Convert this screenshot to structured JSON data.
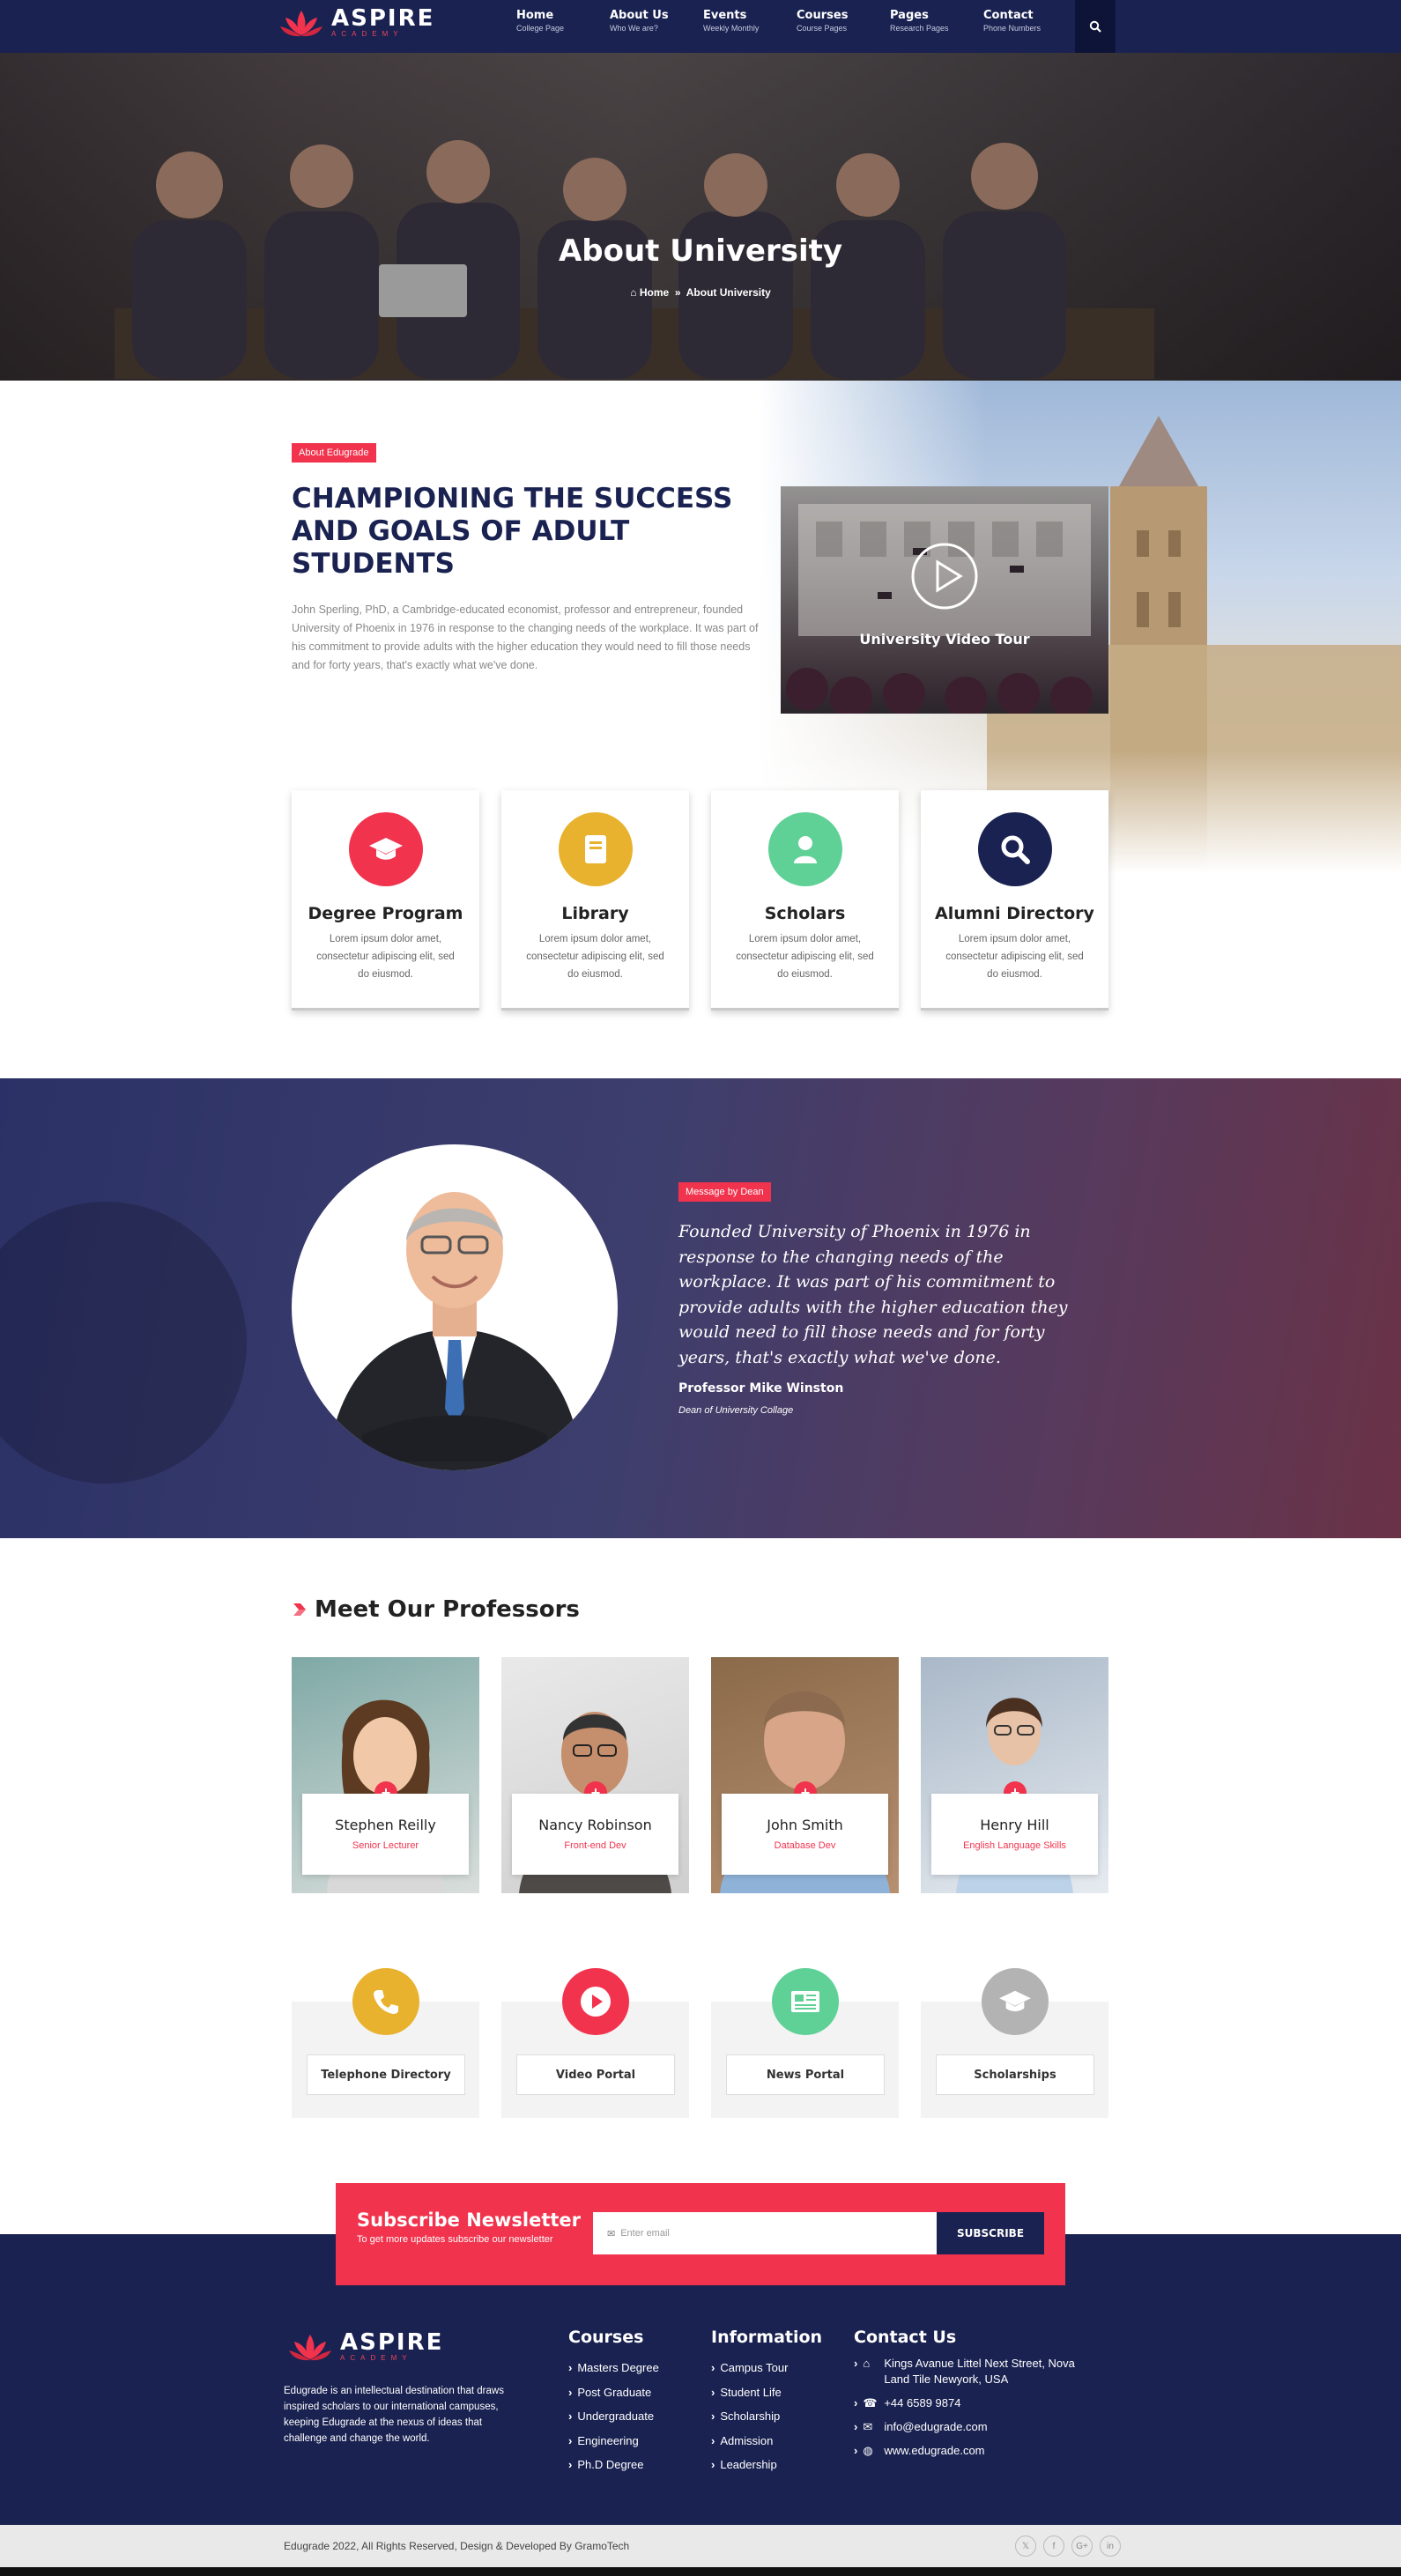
{
  "brand": {
    "name": "ASPIRE",
    "tagline": "ACADEMY",
    "accent": "#f1334d",
    "navy": "#1a2251"
  },
  "nav": {
    "items": [
      {
        "label": "Home",
        "sub": "College Page"
      },
      {
        "label": "About Us",
        "sub": "Who We are?"
      },
      {
        "label": "Events",
        "sub": "Weekly Monthly"
      },
      {
        "label": "Courses",
        "sub": "Course Pages"
      },
      {
        "label": "Pages",
        "sub": "Research Pages"
      },
      {
        "label": "Contact",
        "sub": "Phone Numbers"
      }
    ],
    "search_icon": "search-icon"
  },
  "hero": {
    "title": "About University",
    "breadcrumb": {
      "home": "Home",
      "current": "About University"
    }
  },
  "about": {
    "tag": "About Edugrade",
    "heading": "CHAMPIONING THE SUCCESS AND GOALS OF ADULT STUDENTS",
    "body": "John Sperling, PhD, a Cambridge-educated economist, professor and entrepreneur, founded University of Phoenix in 1976 in response to the changing needs of the workplace. It was part of his commitment to provide adults with the higher education they would need to fill those needs and for forty years, that's exactly what we've done.",
    "video_title": "University Video Tour"
  },
  "features": [
    {
      "title": "Degree Program",
      "desc": "Lorem ipsum dolor amet, consectetur adipiscing elit, sed do eiusmod.",
      "color": "#f1334d",
      "icon": "graduation-cap-icon"
    },
    {
      "title": "Library",
      "desc": "Lorem ipsum dolor amet, consectetur adipiscing elit, sed do eiusmod.",
      "color": "#e8b22e",
      "icon": "book-icon"
    },
    {
      "title": "Scholars",
      "desc": "Lorem ipsum dolor amet, consectetur adipiscing elit, sed do eiusmod.",
      "color": "#5fd197",
      "icon": "user-icon"
    },
    {
      "title": "Alumni Directory",
      "desc": "Lorem ipsum dolor amet, consectetur adipiscing elit, sed do eiusmod.",
      "color": "#1a2251",
      "icon": "search-icon"
    }
  ],
  "dean": {
    "tag": "Message by Dean",
    "quote": "Founded University of Phoenix in 1976 in response to the changing needs of the workplace. It was part of his commitment to provide adults with the higher education they would need to fill those needs and for forty years, that's exactly what we've done.",
    "name": "Professor Mike Winston",
    "role": "Dean of University Collage"
  },
  "professors": {
    "title": "Meet Our Professors",
    "items": [
      {
        "name": "Stephen Reilly",
        "role": "Senior Lecturer"
      },
      {
        "name": "Nancy Robinson",
        "role": "Front-end Dev"
      },
      {
        "name": "John Smith",
        "role": "Database Dev"
      },
      {
        "name": "Henry Hill",
        "role": "English Language Skills"
      }
    ]
  },
  "portals": [
    {
      "label": "Telephone Directory",
      "color": "#e8b22e",
      "icon": "phone-icon"
    },
    {
      "label": "Video Portal",
      "color": "#f1334d",
      "icon": "play-icon"
    },
    {
      "label": "News Portal",
      "color": "#5fd197",
      "icon": "newspaper-icon"
    },
    {
      "label": "Scholarships",
      "color": "#b3b3b3",
      "icon": "graduation-cap-icon"
    }
  ],
  "newsletter": {
    "title": "Subscribe Newsletter",
    "text": "To get more updates subscribe our newsletter",
    "placeholder": "Enter email",
    "button": "SUBSCRIBE"
  },
  "footer": {
    "about": "Edugrade is an intellectual destination that draws inspired scholars to our international campuses, keeping Edugrade at the nexus of ideas that challenge and change the world.",
    "courses": {
      "title": "Courses",
      "items": [
        "Masters Degree",
        "Post Graduate",
        "Undergraduate",
        "Engineering",
        "Ph.D Degree"
      ]
    },
    "information": {
      "title": "Information",
      "items": [
        "Campus Tour",
        "Student Life",
        "Scholarship",
        "Admission",
        "Leadership"
      ]
    },
    "contact": {
      "title": "Contact Us",
      "address": "Kings Avanue Littel Next Street, Nova Land Tile Newyork, USA",
      "phone": "+44 6589 9874",
      "email": "info@edugrade.com",
      "website": "www.edugrade.com"
    },
    "copyright": "Edugrade 2022, All Rights Reserved, Design & Developed By GramoTech",
    "socials": [
      {
        "label": "𝕏",
        "icon": "twitter-icon"
      },
      {
        "label": "f",
        "icon": "facebook-icon"
      },
      {
        "label": "G+",
        "icon": "google-plus-icon"
      },
      {
        "label": "in",
        "icon": "linkedin-icon"
      }
    ]
  }
}
